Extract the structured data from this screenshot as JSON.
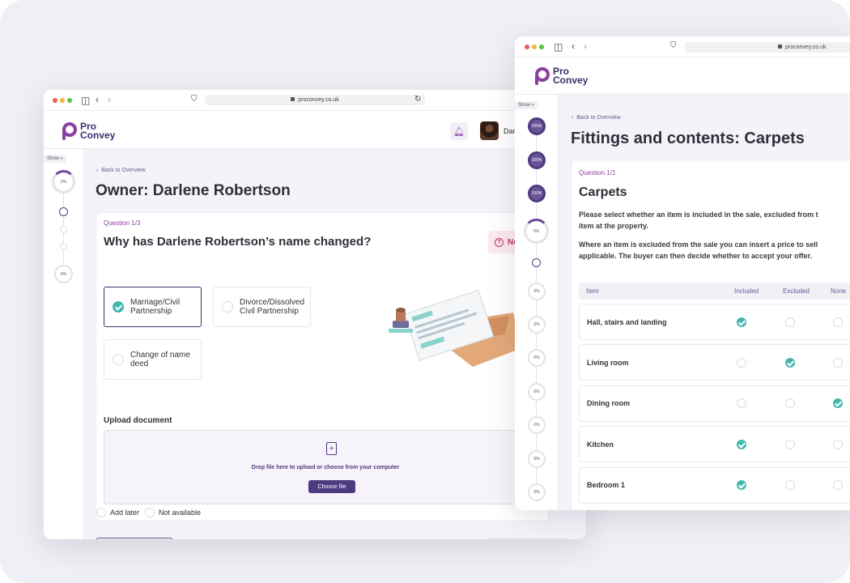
{
  "left_window": {
    "url": "proconvey.co.uk",
    "logo": {
      "line1": "Pro",
      "line2": "Convey"
    },
    "user_name": "Darl",
    "sidebar": {
      "show_label": "Show »",
      "first_progress": "0%",
      "last_progress": "0%"
    },
    "back_link": "Back to Overview",
    "page_title": "Owner: Darlene Robertson",
    "question_label": "Question 1/3",
    "question_title": "Why has Darlene Robertson’s name changed?",
    "help_label": "Ne",
    "options": [
      {
        "label_line1": "Marriage/Civil",
        "label_line2": "Partnership",
        "selected": true
      },
      {
        "label_line1": "Divorce/Dissolved",
        "label_line2": "Civil Partnership",
        "selected": false
      },
      {
        "label_line1": "Change of name",
        "label_line2": "deed",
        "selected": false
      }
    ],
    "upload": {
      "title": "Upload document",
      "hint": "Drop file here to upload or choose from your computer",
      "button": "Choose file"
    },
    "add_later": "Add later",
    "not_available": "Not available"
  },
  "right_window": {
    "url": "proconvey.co.uk",
    "logo": {
      "line1": "Pro",
      "line2": "Convey"
    },
    "sidebar": {
      "show_label": "Show »",
      "progress": [
        "100%",
        "100%",
        "100%",
        "0%",
        "0%",
        "0%",
        "0%",
        "0%",
        "0%",
        "0%",
        "0%"
      ]
    },
    "back_link": "Back to Overview",
    "page_title": "Fittings and contents: Carpets",
    "question_label": "Question 1/1",
    "section_title": "Carpets",
    "paragraph1_line1": "Please select whether an item is included in the sale, excluded from t",
    "paragraph1_line2": "item at the property.",
    "paragraph2_line1": "Where an item is excluded from the sale you can insert a price to sell",
    "paragraph2_line2": "applicable. The buyer can then decide whether to accept your offer.",
    "table": {
      "headers": [
        "Item",
        "Included",
        "Excluded",
        "None"
      ],
      "rows": [
        {
          "item": "Hall, stairs and landing",
          "choice": "Included"
        },
        {
          "item": "Living room",
          "choice": "Excluded"
        },
        {
          "item": "Dining room",
          "choice": "None"
        },
        {
          "item": "Kitchen",
          "choice": "Included"
        },
        {
          "item": "Bedroom 1",
          "choice": "Included"
        }
      ]
    }
  },
  "colors": {
    "brand": "#8b3fa0",
    "primary": "#4e3a7f",
    "check": "#44b8ae",
    "help": "#c0365c"
  }
}
